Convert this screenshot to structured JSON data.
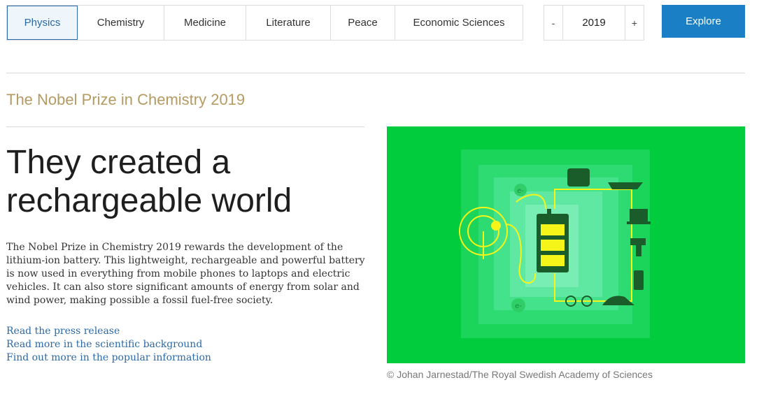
{
  "tabs": [
    "Physics",
    "Chemistry",
    "Medicine",
    "Literature",
    "Peace",
    "Economic Sciences"
  ],
  "year": {
    "minus": "-",
    "value": "2019",
    "plus": "+"
  },
  "explore_label": "Explore",
  "prize_heading": "The Nobel Prize in Chemistry 2019",
  "headline": "They created a rechargeable world",
  "body_text": "The Nobel Prize in Chemistry 2019 rewards the development of the lithium-ion battery. This lightweight, rechargeable and powerful battery is now used in everything from mobile phones to laptops and electric vehicles. It can also store significant amounts of energy from solar and wind power, making possible a fossil fuel-free society.",
  "links": [
    "Read the press release",
    "Read more in the scientific background",
    "Find out more in the popular information"
  ],
  "illustration": {
    "background": "#00cc3d",
    "accent": "#f5f51a",
    "battery_body": "#1a5c2a",
    "electron_label": "e-"
  },
  "image_credit": "© Johan Jarnestad/The Royal Swedish Academy of Sciences",
  "colors": {
    "accent_blue": "#1a7fc4",
    "link_blue": "#2b6aa8",
    "gold": "#b59b63"
  }
}
